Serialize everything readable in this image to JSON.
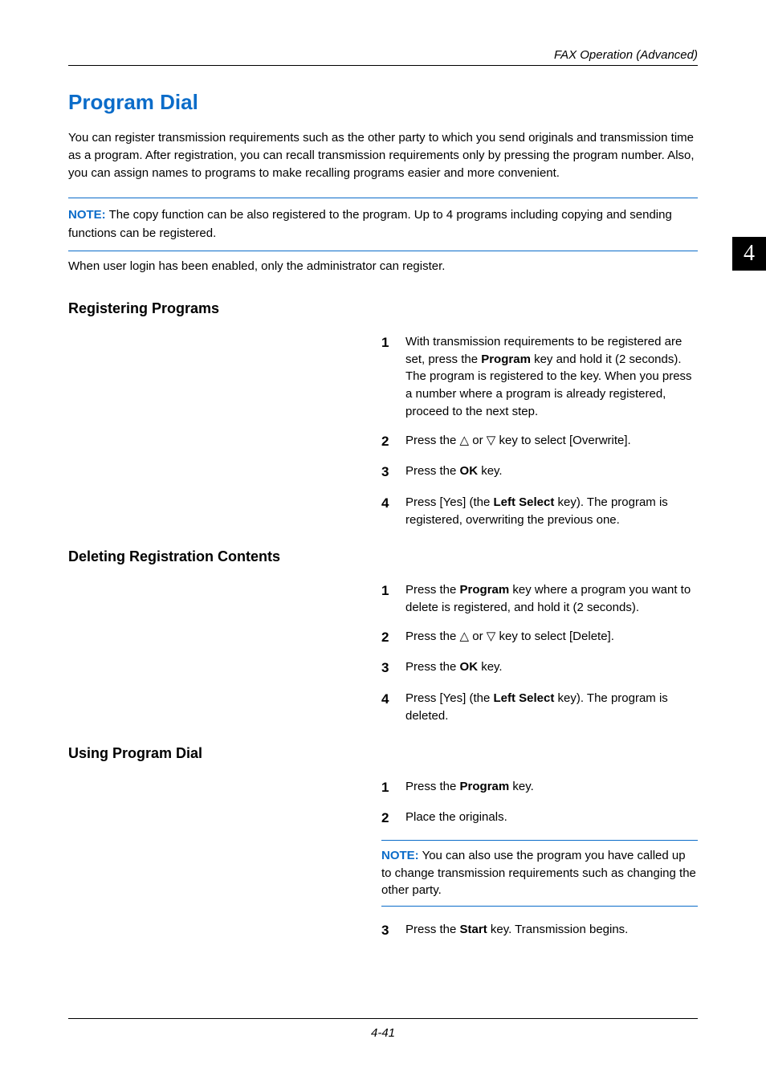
{
  "header": {
    "section": "FAX Operation (Advanced)"
  },
  "chapter_badge": "4",
  "title": "Program Dial",
  "intro": "You can register transmission requirements such as the other party to which you send originals and transmission time as a program. After registration, you can recall transmission requirements only by pressing the program number. Also, you can assign names to programs to make recalling programs easier and more convenient.",
  "note_top": {
    "label": "NOTE:",
    "line1": " The copy function can be also registered to the program. Up to 4 programs including copying and sending functions can be registered.",
    "line2": "When user login has been enabled, only the administrator can register."
  },
  "section_register": {
    "heading": "Registering Programs",
    "steps": {
      "s1_a": "With transmission requirements to be registered are set, press the ",
      "s1_b": "Program",
      "s1_c": " key and hold it (2 seconds). The program is registered to the key. When you press a number where a program is already registered, proceed to the next step.",
      "s2_a": "Press the ",
      "s2_b": " or ",
      "s2_c": " key to select [Overwrite].",
      "s3_a": "Press the ",
      "s3_b": "OK",
      "s3_c": " key.",
      "s4_a": "Press [Yes] (the ",
      "s4_b": "Left Select",
      "s4_c": " key). The program is registered, overwriting the previous one."
    }
  },
  "section_delete": {
    "heading": "Deleting Registration Contents",
    "steps": {
      "s1_a": "Press the ",
      "s1_b": "Program",
      "s1_c": " key where a program you want to delete is registered, and hold it (2 seconds).",
      "s2_a": "Press the ",
      "s2_b": " or ",
      "s2_c": " key to select [Delete].",
      "s3_a": "Press the ",
      "s3_b": "OK",
      "s3_c": " key.",
      "s4_a": "Press [Yes] (the ",
      "s4_b": "Left Select",
      "s4_c": " key). The program is deleted."
    }
  },
  "section_use": {
    "heading": "Using Program Dial",
    "steps": {
      "s1_a": "Press the ",
      "s1_b": "Program",
      "s1_c": " key.",
      "s2": "Place the originals.",
      "note_label": "NOTE:",
      "note_text": " You can also use the program you have called up to change transmission requirements such as changing the other party.",
      "s3_a": "Press the ",
      "s3_b": "Start",
      "s3_c": " key. Transmission begins."
    }
  },
  "glyphs": {
    "up": "△",
    "down": "▽"
  },
  "footer": "4-41"
}
